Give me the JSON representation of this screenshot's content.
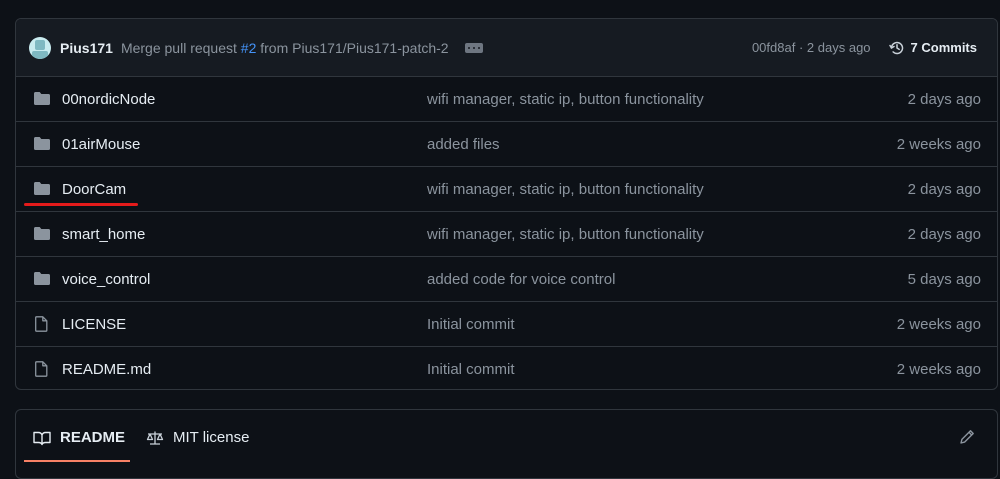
{
  "commit": {
    "author": "Pius171",
    "message_prefix": "Merge pull request",
    "pr_number": "#2",
    "message_suffix": "from Pius171/Pius171-patch-2",
    "hash": "00fd8af",
    "separator": "·",
    "time": "2 days ago",
    "commits_label": "7 Commits"
  },
  "files": [
    {
      "name": "00nordicNode",
      "type": "folder",
      "message": "wifi manager, static ip, button functionality",
      "age": "2 days ago"
    },
    {
      "name": "01airMouse",
      "type": "folder",
      "message": "added files",
      "age": "2 weeks ago"
    },
    {
      "name": "DoorCam",
      "type": "folder",
      "message": "wifi manager, static ip, button functionality",
      "age": "2 days ago",
      "highlighted": true
    },
    {
      "name": "smart_home",
      "type": "folder",
      "message": "wifi manager, static ip, button functionality",
      "age": "2 days ago"
    },
    {
      "name": "voice_control",
      "type": "folder",
      "message": "added code for voice control",
      "age": "5 days ago"
    },
    {
      "name": "LICENSE",
      "type": "file",
      "message": "Initial commit",
      "age": "2 weeks ago"
    },
    {
      "name": "README.md",
      "type": "file",
      "message": "Initial commit",
      "age": "2 weeks ago"
    }
  ],
  "readme_tabs": {
    "readme": "README",
    "license": "MIT license"
  },
  "colors": {
    "background": "#0d1117",
    "border": "#30363d",
    "link": "#4493f8",
    "muted": "#8b949e",
    "annotation": "#e51b1b",
    "tab_accent": "#f78166"
  }
}
